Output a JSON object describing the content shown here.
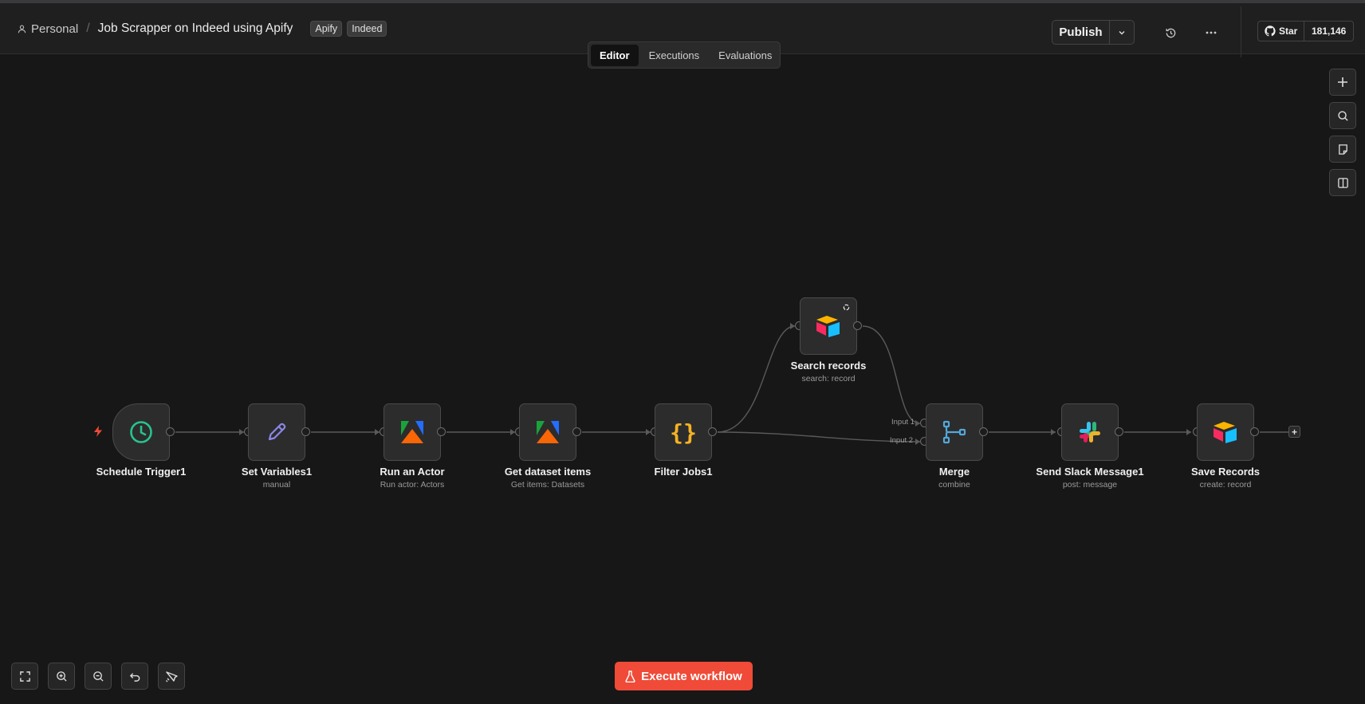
{
  "header": {
    "breadcrumb_project": "Personal",
    "breadcrumb_separator": "/",
    "workflow_title": "Job Scrapper on Indeed using Apify",
    "tags": [
      "Apify",
      "Indeed"
    ],
    "publish_label": "Publish",
    "github_star_label": "Star",
    "github_star_count": "181,146"
  },
  "tabs": [
    {
      "label": "Editor",
      "active": true
    },
    {
      "label": "Executions",
      "active": false
    },
    {
      "label": "Evaluations",
      "active": false
    }
  ],
  "nodes": {
    "schedule_trigger": {
      "label": "Schedule Trigger1",
      "subtitle": ""
    },
    "set_variables": {
      "label": "Set Variables1",
      "subtitle": "manual"
    },
    "run_actor": {
      "label": "Run an Actor",
      "subtitle": "Run actor: Actors"
    },
    "get_dataset": {
      "label": "Get dataset items",
      "subtitle": "Get items: Datasets"
    },
    "filter_jobs": {
      "label": "Filter Jobs1",
      "subtitle": "",
      "glyph": "{}"
    },
    "search_records": {
      "label": "Search records",
      "subtitle": "search: record"
    },
    "merge": {
      "label": "Merge",
      "subtitle": "combine",
      "input1": "Input 1",
      "input2": "Input 2"
    },
    "slack": {
      "label": "Send Slack Message1",
      "subtitle": "post: message"
    },
    "save_records": {
      "label": "Save Records",
      "subtitle": "create: record"
    }
  },
  "add_node_glyph": "+",
  "execute_label": "Execute workflow",
  "colors": {
    "accent": "#ef4b38",
    "trigger_icon": "#27c291",
    "pencil_icon": "#8b87e8",
    "code_icon": "#f4b324",
    "merge_icon": "#52a8dc"
  },
  "icons": {
    "right_toolbar": [
      "plus-icon",
      "search-icon",
      "sticky-note-icon",
      "panel-icon"
    ],
    "bottom_toolbar": [
      "fit-view-icon",
      "zoom-in-icon",
      "zoom-out-icon",
      "undo-icon",
      "tidy-up-icon"
    ]
  }
}
